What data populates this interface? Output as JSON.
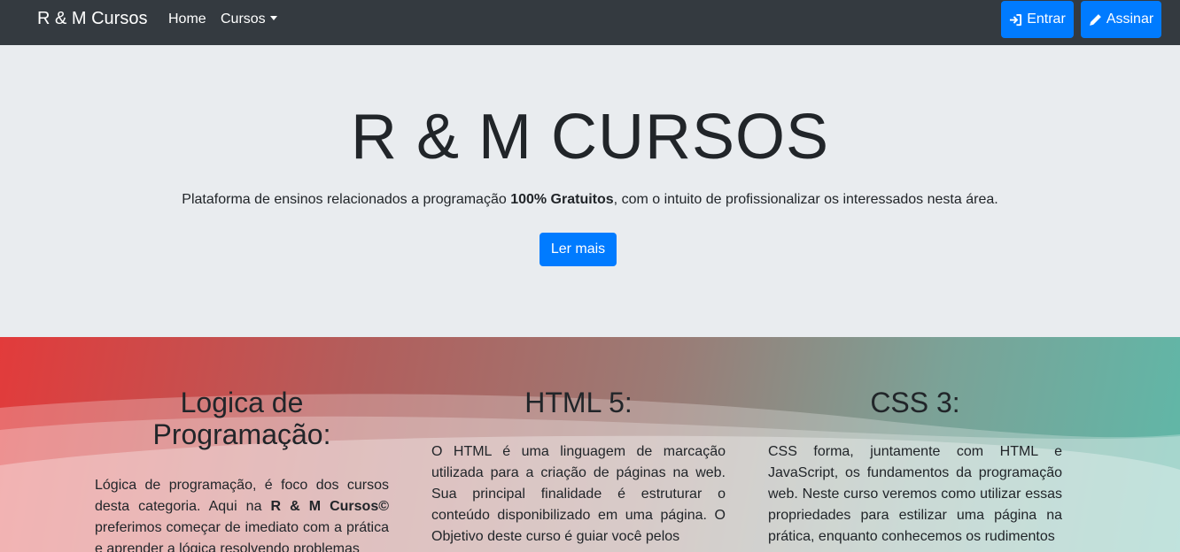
{
  "navbar": {
    "brand": "R & M Cursos",
    "home": "Home",
    "cursos": "Cursos",
    "entrar": "Entrar",
    "assinar": "Assinar"
  },
  "hero": {
    "title": "R & M CURSOS",
    "lead_before": "Plataforma de ensinos relacionados a programação ",
    "lead_bold": "100% Gratuitos",
    "lead_after": ", com o intuito de profissionalizar os interessados nesta área.",
    "button": "Ler mais"
  },
  "courses": [
    {
      "title": "Logica de Programação:",
      "text_before": "Lógica de programação, é foco dos cursos desta categoria. Aqui na ",
      "text_bold": "R & M Cursos©",
      "text_after": " preferimos começar de imediato com a prática e aprender a lógica resolvendo problemas"
    },
    {
      "title": "HTML 5:",
      "text": "O HTML é uma linguagem de marcação utilizada para a criação de páginas na web. Sua principal finalidade é estruturar o conteúdo disponibilizado em uma página. O Objetivo deste curso é guiar você pelos"
    },
    {
      "title": "CSS 3:",
      "text": "CSS forma, juntamente com HTML e JavaScript, os fundamentos da programação web. Neste curso veremos como utilizar essas propriedades para estilizar uma página na prática, enquanto conhecemos os rudimentos"
    }
  ]
}
